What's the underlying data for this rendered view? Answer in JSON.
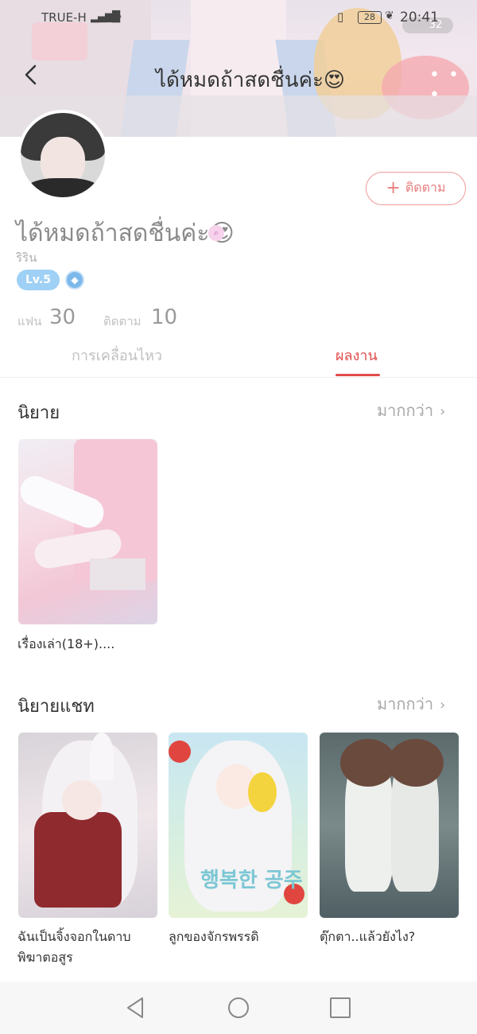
{
  "status_bar": {
    "carrier": "TRUE-H",
    "battery": "28",
    "time": "20:41",
    "pill_text": "32"
  },
  "header": {
    "title": "ได้หมดถ้าสดชื่นค่ะ😍",
    "more_label": "• • •"
  },
  "profile": {
    "follow_label": "ติดตาม",
    "name": "ได้หมดถ้าสดชื่นค่ะ😍",
    "subname": "ริริน",
    "level": "Lv.5",
    "stats": {
      "fans_label": "แฟน",
      "fans_value": "30",
      "following_label": "ติดตาม",
      "following_value": "10"
    }
  },
  "tabs": [
    {
      "label": "การเคลื่อนไหว",
      "active": false
    },
    {
      "label": "ผลงาน",
      "active": true
    }
  ],
  "sections": {
    "novel": {
      "title": "นิยาย",
      "more_label": "มากกว่า",
      "books": [
        {
          "title": "เรื่องเล่า(18+)...."
        }
      ]
    },
    "chat_novel": {
      "title": "นิยายแชท",
      "more_label": "มากกว่า",
      "books": [
        {
          "title_line1": "ฉันเป็นจิ้งจอกในดาบ",
          "title_line2": "พิฆาตอสูร"
        },
        {
          "title_line1": "ลูกของจักรพรรดิ",
          "cover_text": "행복한 공주"
        },
        {
          "title_line1": "ตุ๊กตา..แล้วยังไง?"
        }
      ]
    }
  },
  "colors": {
    "accent": "#e24c4c",
    "follow": "#e97e7e",
    "level_badge": "#9fd0f5"
  },
  "icons": {
    "back": "chevron-left-icon",
    "more": "more-dots-icon",
    "search": "search-icon",
    "vip": "diamond-icon",
    "nav_back": "triangle-back-icon",
    "nav_home": "circle-home-icon",
    "nav_recent": "square-recent-icon"
  }
}
